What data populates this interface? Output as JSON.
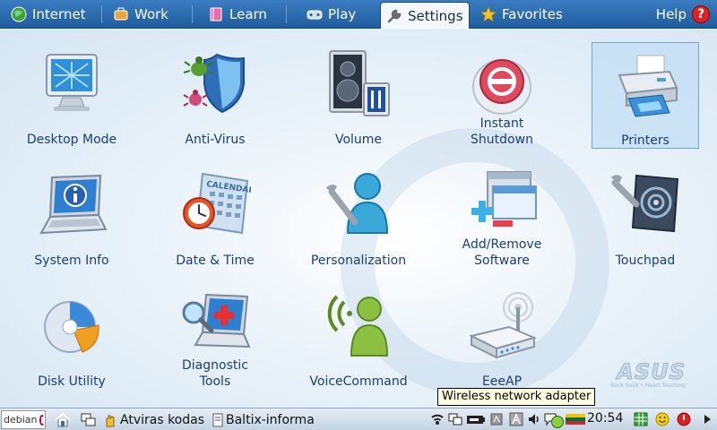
{
  "tabs": [
    {
      "label": "Internet"
    },
    {
      "label": "Work"
    },
    {
      "label": "Learn"
    },
    {
      "label": "Play"
    },
    {
      "label": "Settings"
    },
    {
      "label": "Favorites"
    }
  ],
  "help_label": "Help",
  "help_symbol": "?",
  "apps": [
    {
      "label": "Desktop Mode"
    },
    {
      "label": "Anti-Virus"
    },
    {
      "label": "Volume"
    },
    {
      "label_line1": "Instant",
      "label_line2": "Shutdown"
    },
    {
      "label": "Printers"
    },
    {
      "label": "System Info"
    },
    {
      "label": "Date & Time"
    },
    {
      "label": "Personalization"
    },
    {
      "label_line1": "Add/Remove",
      "label_line2": "Software"
    },
    {
      "label": "Touchpad"
    },
    {
      "label": "Disk Utility"
    },
    {
      "label_line1": "Diagnostic",
      "label_line2": "Tools"
    },
    {
      "label": "VoiceCommand"
    },
    {
      "label": "EeeAP"
    }
  ],
  "selected_app": "Printers",
  "calendar_text": "CALENDAR",
  "tooltip": "Wireless network adapter",
  "watermark": {
    "brand": "ASUS",
    "tagline": "Rock Solid • Heart Touching"
  },
  "taskbar": {
    "start_label": "debian",
    "tasks": [
      {
        "label": "Atviras kodas"
      },
      {
        "label": "Baltix-informa"
      }
    ],
    "clock": "20:54"
  }
}
